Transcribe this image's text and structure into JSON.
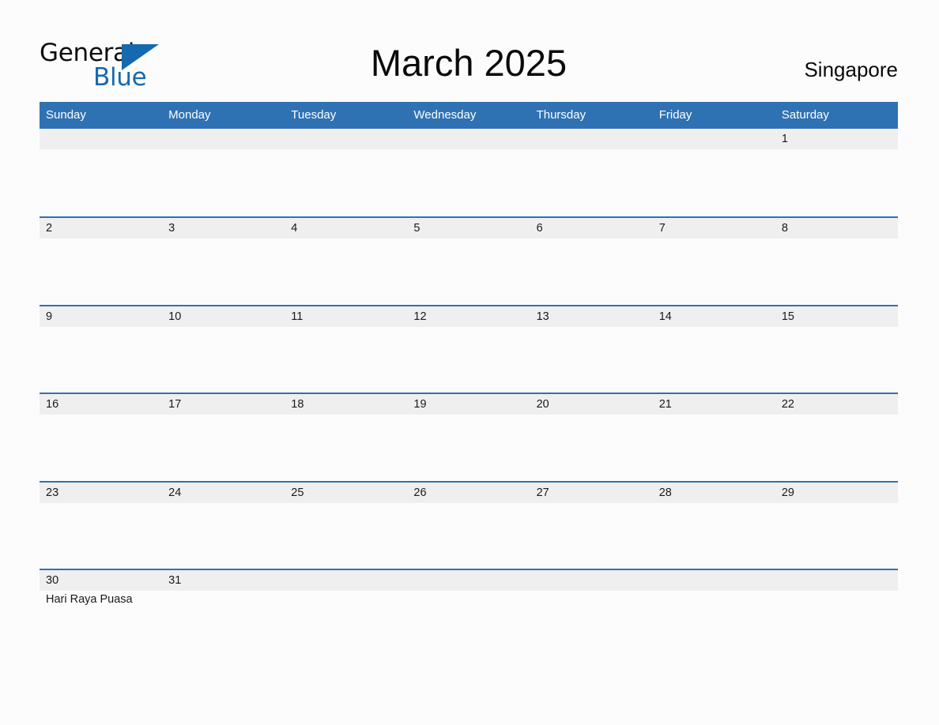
{
  "branding": {
    "logo_text_top": "General",
    "logo_text_bottom": "Blue",
    "logo_triangle_icon": "triangle-flag-icon",
    "brand_blue": "#1569ae"
  },
  "header": {
    "title": "March 2025",
    "locale": "Singapore"
  },
  "theme": {
    "header_blue": "#2f72b3",
    "row_gray": "#efefef",
    "page_background": "#fcfcfc",
    "text_dark": "#1a1a1a"
  },
  "calendar": {
    "weekday_labels": [
      "Sunday",
      "Monday",
      "Tuesday",
      "Wednesday",
      "Thursday",
      "Friday",
      "Saturday"
    ],
    "weeks": [
      {
        "days": [
          {
            "num": "",
            "event": ""
          },
          {
            "num": "",
            "event": ""
          },
          {
            "num": "",
            "event": ""
          },
          {
            "num": "",
            "event": ""
          },
          {
            "num": "",
            "event": ""
          },
          {
            "num": "",
            "event": ""
          },
          {
            "num": "1",
            "event": ""
          }
        ]
      },
      {
        "days": [
          {
            "num": "2",
            "event": ""
          },
          {
            "num": "3",
            "event": ""
          },
          {
            "num": "4",
            "event": ""
          },
          {
            "num": "5",
            "event": ""
          },
          {
            "num": "6",
            "event": ""
          },
          {
            "num": "7",
            "event": ""
          },
          {
            "num": "8",
            "event": ""
          }
        ]
      },
      {
        "days": [
          {
            "num": "9",
            "event": ""
          },
          {
            "num": "10",
            "event": ""
          },
          {
            "num": "11",
            "event": ""
          },
          {
            "num": "12",
            "event": ""
          },
          {
            "num": "13",
            "event": ""
          },
          {
            "num": "14",
            "event": ""
          },
          {
            "num": "15",
            "event": ""
          }
        ]
      },
      {
        "days": [
          {
            "num": "16",
            "event": ""
          },
          {
            "num": "17",
            "event": ""
          },
          {
            "num": "18",
            "event": ""
          },
          {
            "num": "19",
            "event": ""
          },
          {
            "num": "20",
            "event": ""
          },
          {
            "num": "21",
            "event": ""
          },
          {
            "num": "22",
            "event": ""
          }
        ]
      },
      {
        "days": [
          {
            "num": "23",
            "event": ""
          },
          {
            "num": "24",
            "event": ""
          },
          {
            "num": "25",
            "event": ""
          },
          {
            "num": "26",
            "event": ""
          },
          {
            "num": "27",
            "event": ""
          },
          {
            "num": "28",
            "event": ""
          },
          {
            "num": "29",
            "event": ""
          }
        ]
      },
      {
        "days": [
          {
            "num": "30",
            "event": "Hari Raya Puasa"
          },
          {
            "num": "31",
            "event": ""
          },
          {
            "num": "",
            "event": ""
          },
          {
            "num": "",
            "event": ""
          },
          {
            "num": "",
            "event": ""
          },
          {
            "num": "",
            "event": ""
          },
          {
            "num": "",
            "event": ""
          }
        ]
      }
    ]
  }
}
